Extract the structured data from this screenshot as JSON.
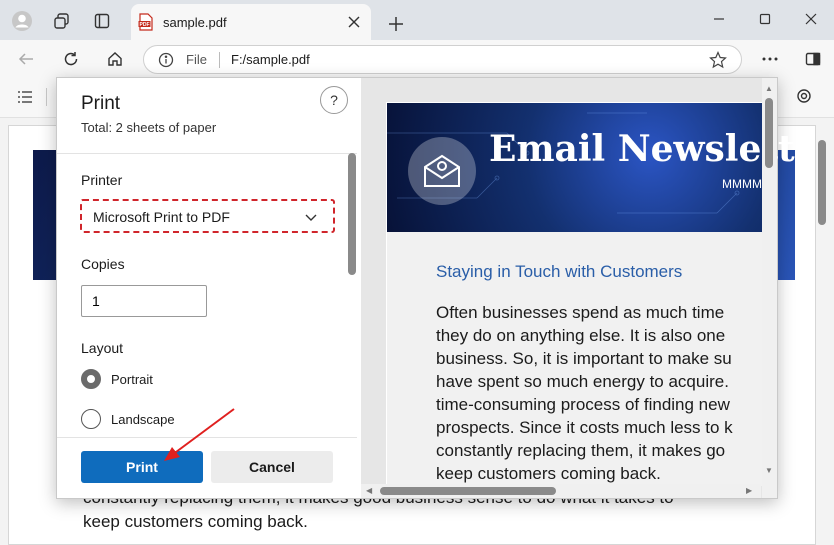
{
  "browser": {
    "tab_title": "sample.pdf",
    "address": {
      "scheme_label": "File",
      "url": "F:/sample.pdf"
    }
  },
  "background": {
    "text_lines": [
      "constantly replacing them, it makes good business sense to do what it takes to",
      "keep customers coming back."
    ]
  },
  "print_dialog": {
    "title": "Print",
    "total": "Total: 2 sheets of paper",
    "help": "?",
    "printer_label": "Printer",
    "printer_value": "Microsoft Print to PDF",
    "copies_label": "Copies",
    "copies_value": "1",
    "layout_label": "Layout",
    "layout_options": [
      {
        "label": "Portrait",
        "selected": true
      },
      {
        "label": "Landscape",
        "selected": false
      }
    ],
    "print_button": "Print",
    "cancel_button": "Cancel",
    "accent_color": "#0f6cbd",
    "highlight_color": "#d0252b"
  },
  "preview": {
    "heading": "Email Newslett",
    "subheading": "MMMM",
    "section_title": "Staying in Touch with Customers",
    "paragraph_lines": [
      "Often businesses spend as much time",
      "they do on anything else. It is also one",
      "business. So, it is important to make su",
      "have spent so much energy to acquire.",
      "time-consuming process of finding new",
      "prospects. Since it costs much less to k",
      "constantly replacing them, it makes go",
      "keep customers coming back."
    ]
  },
  "icons": [
    "profile-icon",
    "workspaces-icon",
    "tab-actions-icon",
    "pdf-file-icon",
    "close-icon",
    "plus-icon",
    "minimize-icon",
    "maximize-icon",
    "window-close-icon",
    "back-icon",
    "refresh-icon",
    "home-icon",
    "info-icon",
    "favorite-star-icon",
    "more-icon",
    "extensions-icon",
    "contents-icon",
    "chevron-down-icon",
    "mail-icon"
  ]
}
